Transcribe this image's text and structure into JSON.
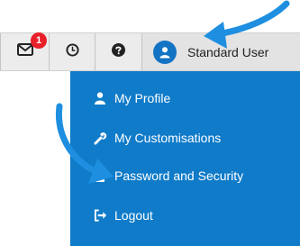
{
  "toolbar": {
    "mail_badge": "1",
    "user_name": "Standard User"
  },
  "menu": {
    "items": [
      {
        "label": "My Profile",
        "icon": "person-icon"
      },
      {
        "label": "My Customisations",
        "icon": "wrench-icon"
      },
      {
        "label": "Password and Security",
        "icon": "lock-icon"
      },
      {
        "label": "Logout",
        "icon": "logout-icon"
      }
    ]
  },
  "colors": {
    "menu_bg": "#0f7bc9",
    "badge": "#e8202a",
    "arrow": "#1e8fe0"
  }
}
